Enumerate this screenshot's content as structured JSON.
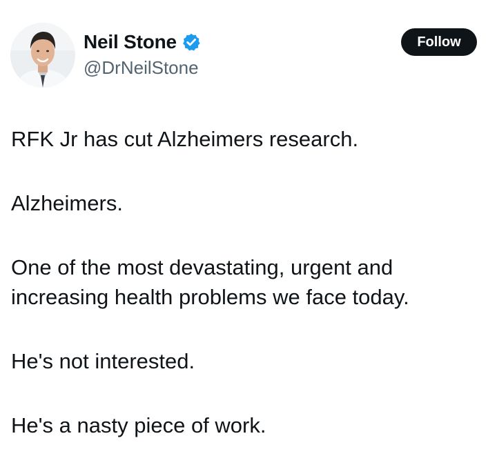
{
  "author": {
    "display_name": "Neil Stone",
    "handle": "@DrNeilStone",
    "verified": true,
    "verified_badge_color": "#1d9bf0"
  },
  "actions": {
    "follow_label": "Follow"
  },
  "tweet": {
    "paragraphs": [
      "RFK Jr has cut Alzheimers research.",
      "Alzheimers.",
      "One of the most devastating, urgent and",
      "increasing health problems we face today.",
      "He's not interested.",
      "He's a nasty piece of work."
    ]
  }
}
